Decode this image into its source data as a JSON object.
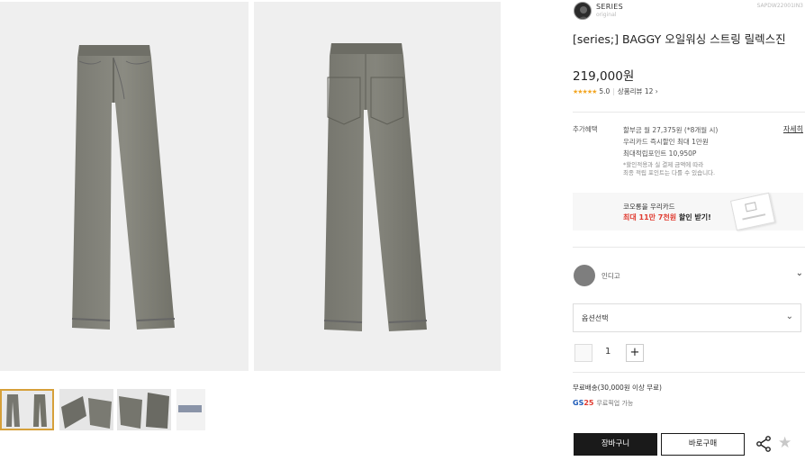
{
  "brand": {
    "name": "SERIES",
    "sub": "original",
    "code": "SAPDW22001IN3"
  },
  "title": "[series;] BAGGY 오일워싱 스트링 릴렉스진",
  "price": "219,000원",
  "rating": {
    "stars": "★★★★★",
    "score": "5.0",
    "reviews_label": "상품리뷰 12 ›"
  },
  "benefits": {
    "label": "추가혜택",
    "detail_link": "자세히",
    "lines": [
      "할부금 월 27,375원 (*8개월 시)",
      "우리카드 즉시할인 최대 1만원",
      "최대적립포인트 10,950P"
    ],
    "notes": [
      "*할인적용과 실 결제 금액에 따라",
      "최종 적립 포인트는 다를 수 있습니다."
    ]
  },
  "card_banner": {
    "line1": "코오롱을 우리카드",
    "highlight": "최대 11만 7천원",
    "line2_rest": " 할인 받기!"
  },
  "color": {
    "name": "인디고",
    "swatch_color": "#7e7e7e",
    "icon": "chevron-down-icon"
  },
  "option": {
    "label": "옵션선택",
    "icon": "chevron-down-icon"
  },
  "quantity": {
    "value": "1",
    "plus_label": "+"
  },
  "shipping": {
    "text": "무료배송(30,000원 이상 무료)",
    "gs_logo_g": "GS",
    "gs_logo_n": "25",
    "gs_text": "무료픽업 가능"
  },
  "buttons": {
    "cart": "장바구니",
    "buy": "바로구매"
  },
  "colors": {
    "accent": "#1a1a1a",
    "price_highlight": "#e03c31",
    "selected_thumb": "#d6a03a",
    "star": "#f2a623"
  }
}
